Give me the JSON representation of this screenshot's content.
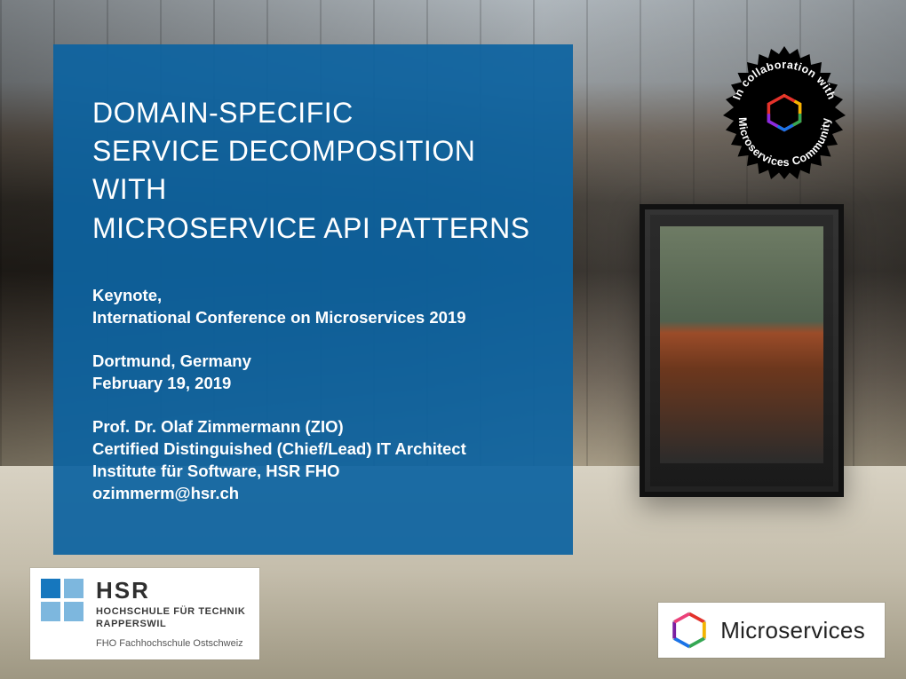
{
  "title": {
    "line1": "DOMAIN-SPECIFIC",
    "line2": "SERVICE DECOMPOSITION",
    "line3": "WITH",
    "line4": "MICROSERVICE API PATTERNS"
  },
  "event": {
    "line1": "Keynote,",
    "line2": "International Conference on Microservices 2019"
  },
  "location": {
    "line1": "Dortmund, Germany",
    "line2": "February 19, 2019"
  },
  "author": {
    "line1": "Prof. Dr. Olaf Zimmermann (ZIO)",
    "line2": "Certified Distinguished (Chief/Lead) IT Architect",
    "line3": "Institute für Software, HSR FHO",
    "line4": "ozimmerm@hsr.ch"
  },
  "hsr": {
    "abbr": "HSR",
    "line1": "HOCHSCHULE FÜR TECHNIK",
    "line2": "RAPPERSWIL",
    "fho": "FHO Fachhochschule Ostschweiz"
  },
  "microservices": {
    "label": "Microservices"
  },
  "badge": {
    "top": "In collaboration with",
    "bottom": "Microservices Community"
  }
}
